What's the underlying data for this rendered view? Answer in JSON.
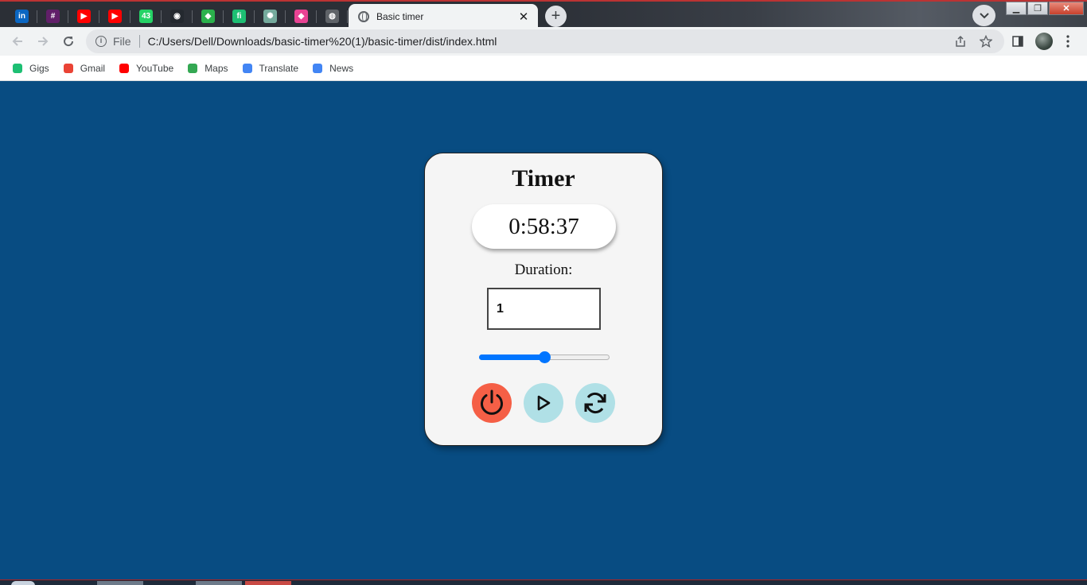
{
  "browser": {
    "active_tab": {
      "title": "Basic timer"
    },
    "pinned_tabs": [
      {
        "icon": "linkedin-icon",
        "color": "#0a66c2",
        "glyph": "in"
      },
      {
        "icon": "slack-icon",
        "color": "#611f69",
        "glyph": "#"
      },
      {
        "icon": "youtube-icon",
        "color": "#ff0000",
        "glyph": "▶"
      },
      {
        "icon": "youtube-icon",
        "color": "#ff0000",
        "glyph": "▶"
      },
      {
        "icon": "whatsapp-icon",
        "color": "#25d366",
        "glyph": "43"
      },
      {
        "icon": "github-icon",
        "color": "#24292f",
        "glyph": "◉"
      },
      {
        "icon": "feedly-icon",
        "color": "#2bb24c",
        "glyph": "◆"
      },
      {
        "icon": "fiverr-icon",
        "color": "#1dbf73",
        "glyph": "fi"
      },
      {
        "icon": "chatgpt-icon",
        "color": "#74aa9c",
        "glyph": "✺"
      },
      {
        "icon": "box-app-icon",
        "color": "#e84393",
        "glyph": "◆"
      },
      {
        "icon": "globe-icon",
        "color": "#5f6368",
        "glyph": "◍"
      }
    ],
    "address": {
      "scheme_label": "File",
      "url": "C:/Users/Dell/Downloads/basic-timer%20(1)/basic-timer/dist/index.html"
    },
    "bookmarks": [
      {
        "label": "Gigs",
        "icon": "fiverr-icon",
        "color": "#1dbf73"
      },
      {
        "label": "Gmail",
        "icon": "gmail-icon",
        "color": "#ea4335"
      },
      {
        "label": "YouTube",
        "icon": "youtube-icon",
        "color": "#ff0000"
      },
      {
        "label": "Maps",
        "icon": "maps-icon",
        "color": "#34a853"
      },
      {
        "label": "Translate",
        "icon": "translate-icon",
        "color": "#4285f4"
      },
      {
        "label": "News",
        "icon": "news-icon",
        "color": "#4285f4"
      }
    ]
  },
  "timer": {
    "heading": "Timer",
    "display": "0:58:37",
    "duration_label": "Duration:",
    "duration_value": "1",
    "slider_fraction": 0.5,
    "buttons": {
      "power": {
        "icon": "power-icon",
        "color": "#f55f46"
      },
      "play": {
        "icon": "play-icon",
        "color": "#b0e0e6"
      },
      "reset": {
        "icon": "refresh-icon",
        "color": "#b0e0e6"
      }
    }
  },
  "colors": {
    "page_background": "#084c82",
    "card_background": "#f5f5f5",
    "slider_accent": "#0075ff"
  }
}
